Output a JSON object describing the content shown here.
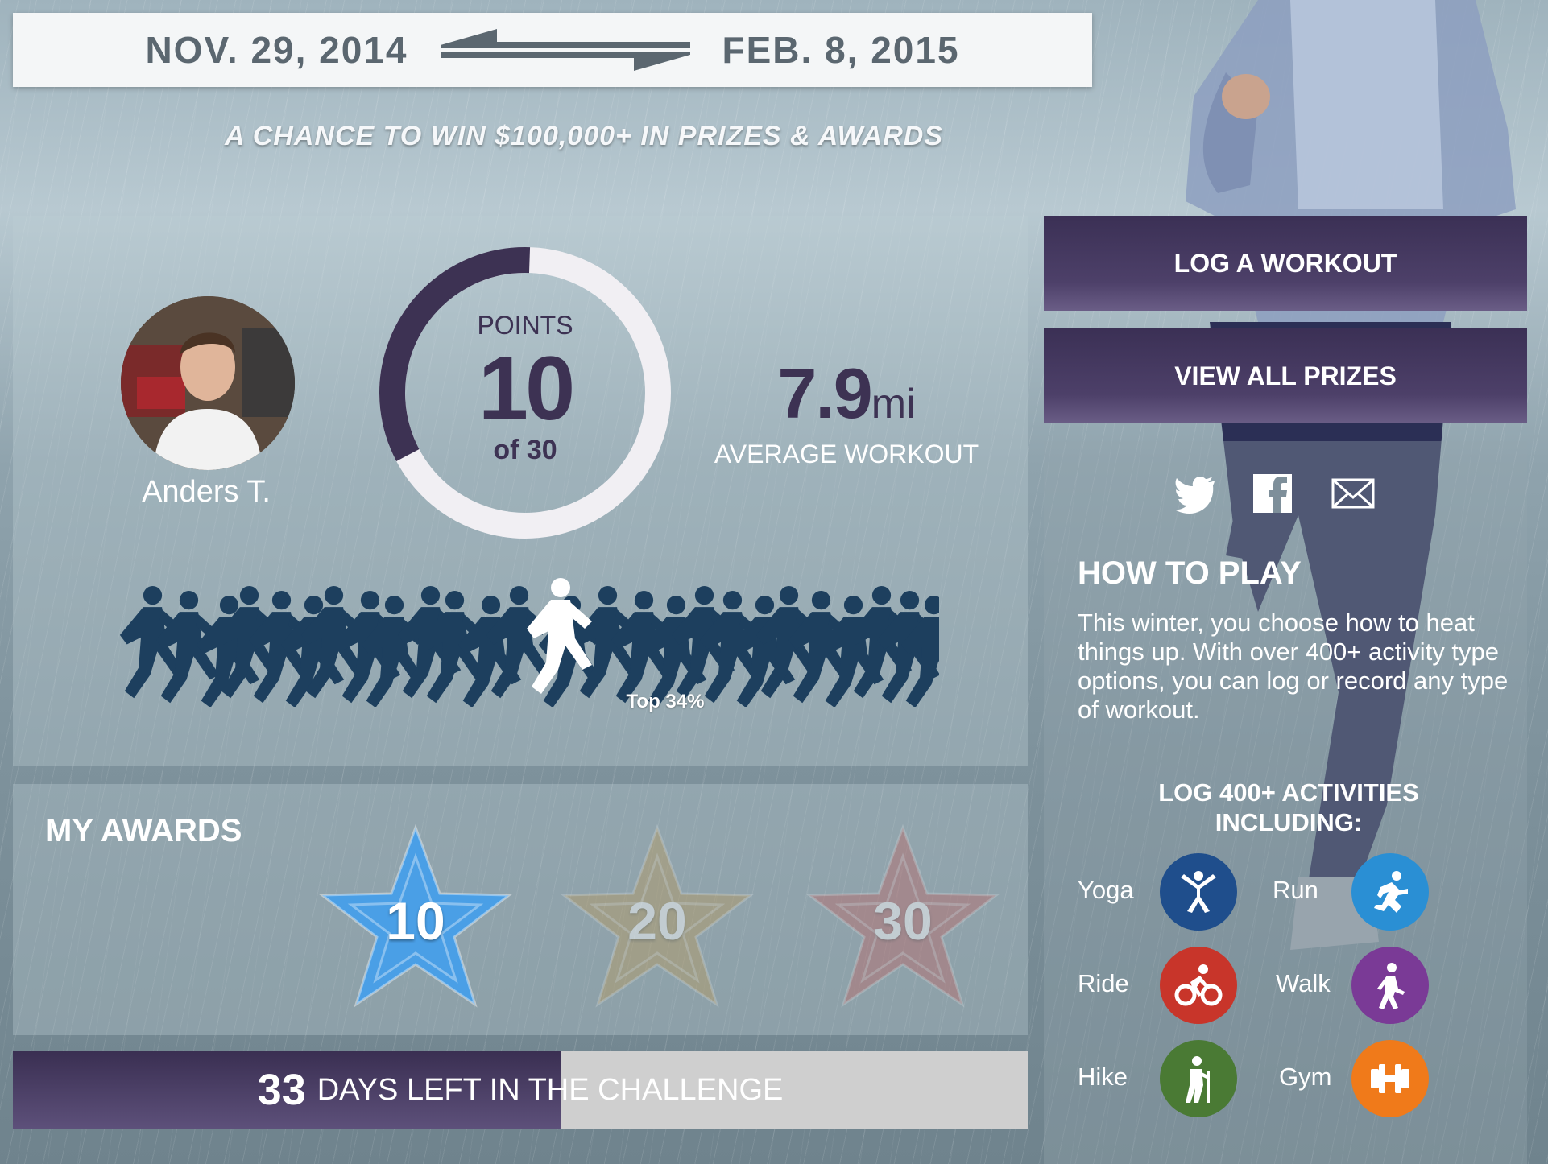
{
  "header": {
    "start_date": "NOV. 29, 2014",
    "end_date": "FEB. 8, 2015",
    "tagline": "A CHANCE TO WIN $100,000+ IN PRIZES & AWARDS"
  },
  "profile": {
    "name": "Anders T.",
    "points_label": "POINTS",
    "points": "10",
    "points_total": "of 30",
    "points_progress": 0.333,
    "avg_workout_value": "7.9",
    "avg_workout_unit": "mi",
    "avg_workout_label": "AVERAGE WORKOUT",
    "rank_label": "Top 34%"
  },
  "awards": {
    "title": "MY AWARDS",
    "items": [
      {
        "value": "10",
        "color": "#4a9fe6",
        "earned": true
      },
      {
        "value": "20",
        "color": "#b59a62",
        "earned": false
      },
      {
        "value": "30",
        "color": "#b86a6a",
        "earned": false
      }
    ]
  },
  "countdown": {
    "days": "33",
    "label": "DAYS LEFT IN THE CHALLENGE",
    "elapsed_fraction": 0.54
  },
  "actions": {
    "log_workout": "LOG A WORKOUT",
    "view_prizes": "VIEW ALL PRIZES"
  },
  "social": [
    "twitter-icon",
    "facebook-icon",
    "email-icon"
  ],
  "how_to_play": {
    "title": "HOW TO PLAY",
    "text": "This winter, you choose how to heat things up. With over 400+ activity type options, you can log or record any type of workout."
  },
  "activities": {
    "title": "LOG 400+ ACTIVITIES INCLUDING:",
    "items": [
      {
        "label": "Yoga",
        "icon": "yoga-icon",
        "color": "#1f4e8c"
      },
      {
        "label": "Run",
        "icon": "run-icon",
        "color": "#2a8fd4"
      },
      {
        "label": "Ride",
        "icon": "bike-icon",
        "color": "#c8352a"
      },
      {
        "label": "Walk",
        "icon": "walk-icon",
        "color": "#7a3a96"
      },
      {
        "label": "Hike",
        "icon": "hike-icon",
        "color": "#4a7a34"
      },
      {
        "label": "Gym",
        "icon": "dumbbell-icon",
        "color": "#f07a1a"
      }
    ]
  }
}
